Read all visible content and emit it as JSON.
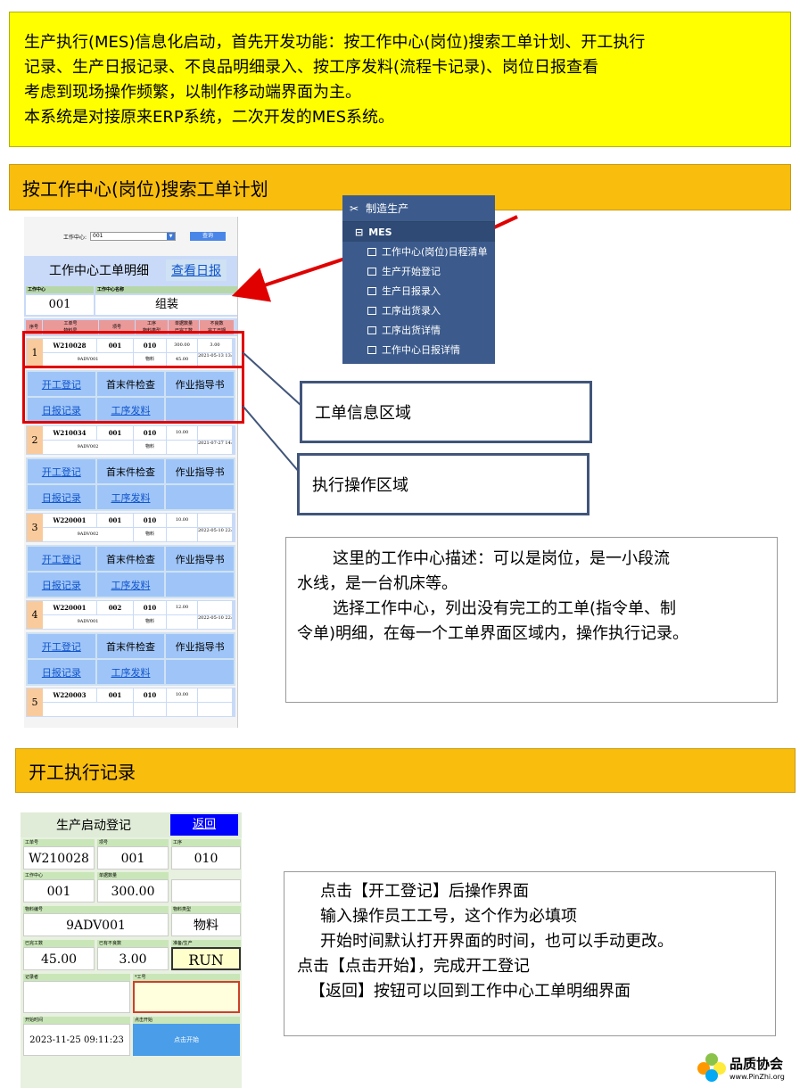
{
  "intro": {
    "lines": [
      "生产执行(MES)信息化启动，首先开发功能：按工作中心(岗位)搜索工单计划、开工执行",
      "记录、生产日报记录、不良品明细录入、按工序发料(流程卡记录)、岗位日报查看",
      "考虑到现场操作频繁，以制作移动端界面为主。",
      "本系统是对接原来ERP系统，二次开发的MES系统。"
    ]
  },
  "section1": {
    "title": "按工作中心(岗位)搜索工单计划"
  },
  "section2": {
    "title": "开工执行记录"
  },
  "phone1": {
    "search_label": "工作中心:",
    "search_value": "001",
    "query_button": "查询",
    "title": "工作中心工单明细",
    "view_report": "查看日报",
    "wc_label": "工作中心",
    "wc_name_label": "工作中心名称",
    "wc_value": "001",
    "wc_name": "组装",
    "headers": [
      "序号",
      "工单号\n物料号",
      "项号",
      "工序\n物料类型",
      "单据数量\n已完工数量",
      "不良数\n完工日期"
    ],
    "h_seq": "序号",
    "h_order": "工单号",
    "h_material": "物料号",
    "h_item": "项号",
    "h_proc": "工序",
    "h_mtype": "物料类型",
    "h_qty": "单据数量",
    "h_done": "已完工数",
    "h_bad": "不良数",
    "h_date": "完工日期",
    "records": [
      {
        "num": "1",
        "order": "W210028",
        "item": "001",
        "proc": "010",
        "qty": "300.00",
        "bad": "3.00",
        "mat": "9ADV001",
        "mtype": "物料",
        "done": "45.00",
        "date": "2021-05-13 13:41:09"
      },
      {
        "num": "2",
        "order": "W210034",
        "item": "001",
        "proc": "010",
        "qty": "10.00",
        "bad": "",
        "mat": "9ADV002",
        "mtype": "物料",
        "done": "",
        "date": "2021-07-27 14:42:28"
      },
      {
        "num": "3",
        "order": "W220001",
        "item": "001",
        "proc": "010",
        "qty": "10.00",
        "bad": "",
        "mat": "9ADV002",
        "mtype": "物料",
        "done": "",
        "date": "2022-05-10 22:20:52"
      },
      {
        "num": "4",
        "order": "W220001",
        "item": "002",
        "proc": "010",
        "qty": "12.00",
        "bad": "",
        "mat": "9ADV001",
        "mtype": "物料",
        "done": "",
        "date": "2022-05-10 22:23:19"
      },
      {
        "num": "5",
        "order": "W220003",
        "item": "001",
        "proc": "010",
        "qty": "10.00",
        "bad": "",
        "mat": "",
        "mtype": "",
        "done": "",
        "date": ""
      }
    ],
    "actions": {
      "start": "开工登记",
      "inspect": "首末件检查",
      "guide": "作业指导书",
      "daily": "日报记录",
      "issue": "工序发料"
    }
  },
  "callouts": {
    "order_area": "工单信息区域",
    "exec_area": "执行操作区域"
  },
  "menu": {
    "title": "制造生产",
    "group": "MES",
    "items": [
      "工作中心(岗位)日程清单",
      "生产开始登记",
      "生产日报录入",
      "工序出货录入",
      "工序出货详情",
      "工作中心日报详情"
    ]
  },
  "desc1": {
    "lines": [
      "这里的工作中心描述：可以是岗位，是一小段流",
      "水线，是一台机床等。",
      "选择工作中心，列出没有完工的工单(指令单、制",
      "令单)明细，在每一个工单界面区域内，操作执行记录。"
    ]
  },
  "phone2": {
    "title": "生产启动登记",
    "back": "返回",
    "l_order": "工单号",
    "v_order": "W210028",
    "l_item": "项号",
    "v_item": "001",
    "l_proc": "工序",
    "v_proc": "010",
    "l_wc": "工作中心",
    "v_wc": "001",
    "l_qty": "单据数量",
    "v_qty": "300.00",
    "l_mat": "物料编号",
    "v_mat": "9ADV001",
    "l_mtype": "物料类型",
    "v_mtype": "物料",
    "l_done": "已完工数",
    "v_done": "45.00",
    "l_bad": "已有不良数",
    "v_bad": "3.00",
    "l_status": "准备/生产",
    "v_status": "RUN",
    "l_recorder": "记录者",
    "l_empno": "*工号",
    "l_start": "开始时间",
    "v_start": "2023-11-25 09:11:23",
    "l_click": "点击开始",
    "start_btn": "点击开始"
  },
  "desc2": {
    "lines": [
      "点击【开工登记】后操作界面",
      "输入操作员工工号，这个作为必填项",
      "开始时间默认打开界面的时间，也可以手动更改。",
      "点击【点击开始】，完成开工登记",
      "【返回】按钮可以回到工作中心工单明细界面"
    ]
  },
  "logo": {
    "name": "品质协会",
    "url": "www.PinZhi.org"
  },
  "colors": {
    "intro_bg": "#ffff00",
    "section_bg": "#f9bd0e",
    "arrow": "#e00000",
    "callout_border": "#41557a"
  }
}
